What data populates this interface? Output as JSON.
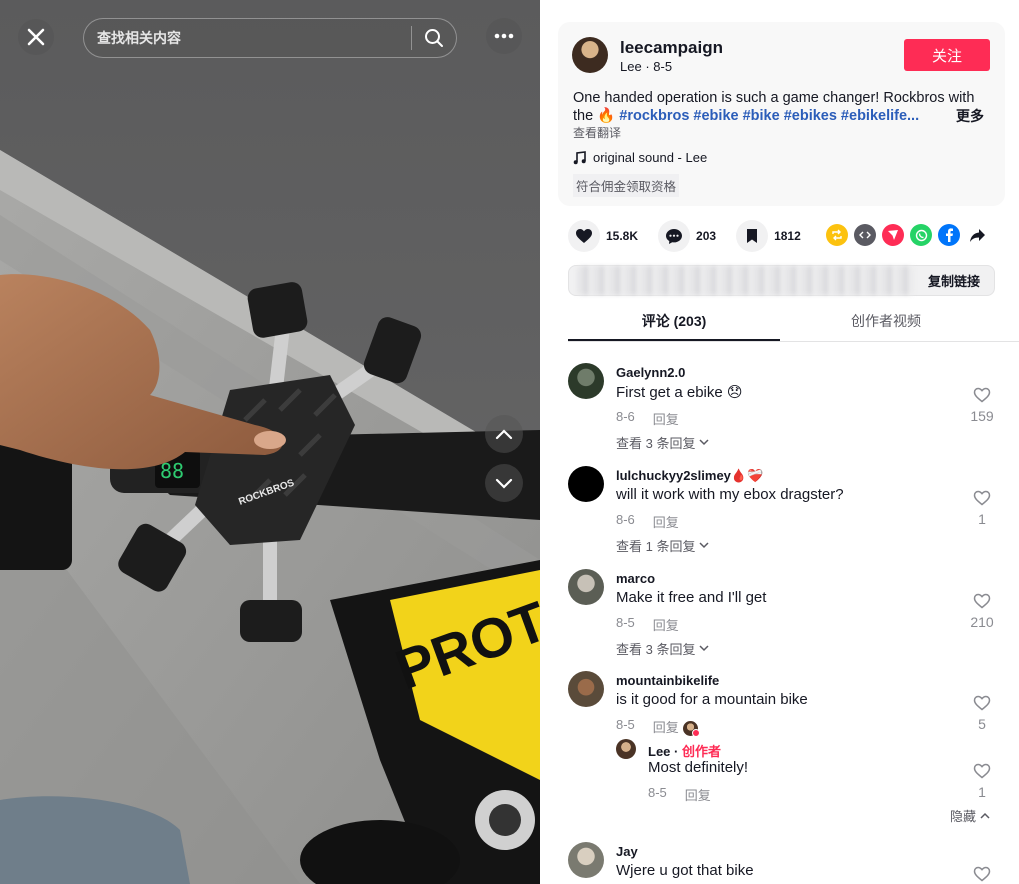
{
  "video": {
    "search_placeholder": "查找相关内容",
    "close_icon": "close-icon",
    "more_icon": "more-dots-icon",
    "nav_up_icon": "chevron-up-icon",
    "nav_down_icon": "chevron-down-icon",
    "mount_brand": "ROCKBROS",
    "bike_brand": "PROT"
  },
  "author": {
    "username": "leecampaign",
    "nickname": "Lee",
    "date": "8-5",
    "follow_label": "关注"
  },
  "caption": {
    "text": "One handed operation is such a game changer! Rockbros with the 🔥",
    "hashtags": "#rockbros #ebike #bike #ebikes #ebikelife...",
    "more_label": "更多",
    "translate_label": "查看翻译",
    "sound": "original sound - Lee",
    "commission": "符合佣金领取资格"
  },
  "stats": {
    "likes": "15.8K",
    "comments": "203",
    "saves": "1812"
  },
  "share": {
    "copy_link_label": "复制链接",
    "colors": {
      "repost": "#fcc20f",
      "embed": "#5a5a62",
      "send": "#fe2c55",
      "whatsapp": "#25d366",
      "facebook": "#0075fa"
    }
  },
  "tabs": {
    "comments_label": "评论 (203)",
    "creator_videos_label": "创作者视频"
  },
  "comments": [
    {
      "user": "Gaelynn2.0",
      "text": "First get a ebike 😞",
      "date": "8-6",
      "reply": "回复",
      "likes": "159",
      "view_replies": "查看 3 条回复"
    },
    {
      "user": "lulchuckyy2slimey🩸❤️‍🩹",
      "text": "will it work with my ebox dragster?",
      "date": "8-6",
      "reply": "回复",
      "likes": "1",
      "view_replies": "查看 1 条回复"
    },
    {
      "user": "marco",
      "text": "Make it free and I'll get",
      "date": "8-5",
      "reply": "回复",
      "likes": "210",
      "view_replies": "查看 3 条回复"
    },
    {
      "user": "mountainbikelife",
      "text": "is it good for a mountain bike",
      "date": "8-5",
      "reply": "回复",
      "likes": "5"
    },
    {
      "user": "Jay",
      "text": "Wjere u got that bike",
      "likes": ""
    }
  ],
  "reply": {
    "user": "Lee",
    "separator": " · ",
    "badge": "创作者",
    "text": "Most definitely!",
    "date": "8-5",
    "reply": "回复",
    "likes": "1"
  },
  "hide_label": "隐藏"
}
